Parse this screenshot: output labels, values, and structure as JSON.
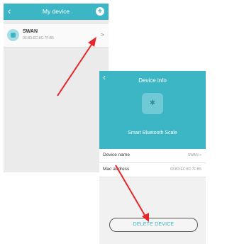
{
  "list_screen": {
    "title": "My device",
    "back_icon": "chevron-left-icon",
    "add_icon": "plus-circle-icon",
    "device": {
      "name": "SWAN",
      "mac": "03:B3:EC:8C:7F:B5",
      "icon": "scale-icon"
    }
  },
  "info_screen": {
    "title": "Device info",
    "back_icon": "chevron-left-icon",
    "scale_name": "Smart Bluetooth Scale",
    "rows": {
      "device_name_label": "Device name",
      "device_name_value": "SWAN >",
      "mac_label": "Mac address",
      "mac_value": "03:B3:EC:8C:7F:B5"
    },
    "delete_label": "DELETE DEVICE"
  },
  "colors": {
    "accent": "#3cb6c5",
    "arrow": "#e8262a"
  }
}
